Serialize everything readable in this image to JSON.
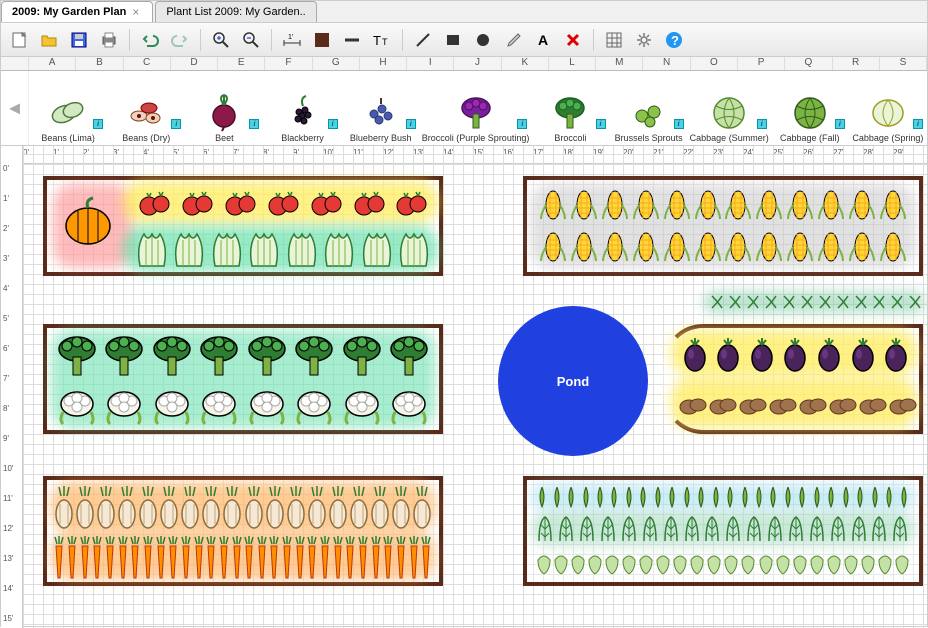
{
  "tabs": [
    {
      "label": "2009: My Garden Plan",
      "active": true,
      "closable": true
    },
    {
      "label": "Plant List 2009: My Garden..",
      "active": false,
      "closable": false
    }
  ],
  "columns": [
    "A",
    "B",
    "C",
    "D",
    "E",
    "F",
    "G",
    "H",
    "I",
    "J",
    "K",
    "L",
    "M",
    "N",
    "O",
    "P",
    "Q",
    "R",
    "S"
  ],
  "plants": [
    {
      "name": "Beans (Lima)",
      "icon": "beans"
    },
    {
      "name": "Beans (Dry)",
      "icon": "beans-dry"
    },
    {
      "name": "Beet",
      "icon": "beet"
    },
    {
      "name": "Blackberry",
      "icon": "blackberry"
    },
    {
      "name": "Blueberry Bush",
      "icon": "blueberry"
    },
    {
      "name": "Broccoli (Purple Sprouting)",
      "icon": "broccoli-purple"
    },
    {
      "name": "Broccoli",
      "icon": "broccoli"
    },
    {
      "name": "Brussels Sprouts",
      "icon": "brussels"
    },
    {
      "name": "Cabbage (Summer)",
      "icon": "cabbage-summer"
    },
    {
      "name": "Cabbage (Fall)",
      "icon": "cabbage-fall"
    },
    {
      "name": "Cabbage (Spring)",
      "icon": "cabbage-spring"
    }
  ],
  "ruler_h": [
    "0'",
    "1'",
    "2'",
    "3'",
    "4'",
    "5'",
    "6'",
    "7'",
    "8'",
    "9'",
    "10'",
    "11'",
    "12'",
    "13'",
    "14'",
    "15'",
    "16'",
    "17'",
    "18'",
    "19'",
    "20'",
    "21'",
    "22'",
    "23'",
    "24'",
    "25'",
    "26'",
    "27'",
    "28'",
    "29'"
  ],
  "ruler_v": [
    "0'",
    "1'",
    "2'",
    "3'",
    "4'",
    "5'",
    "6'",
    "7'",
    "8'",
    "9'",
    "10'",
    "11'",
    "12'",
    "13'",
    "14'",
    "15'"
  ],
  "pond_label": "Pond",
  "info_badge": "i",
  "close_glyph": "×"
}
